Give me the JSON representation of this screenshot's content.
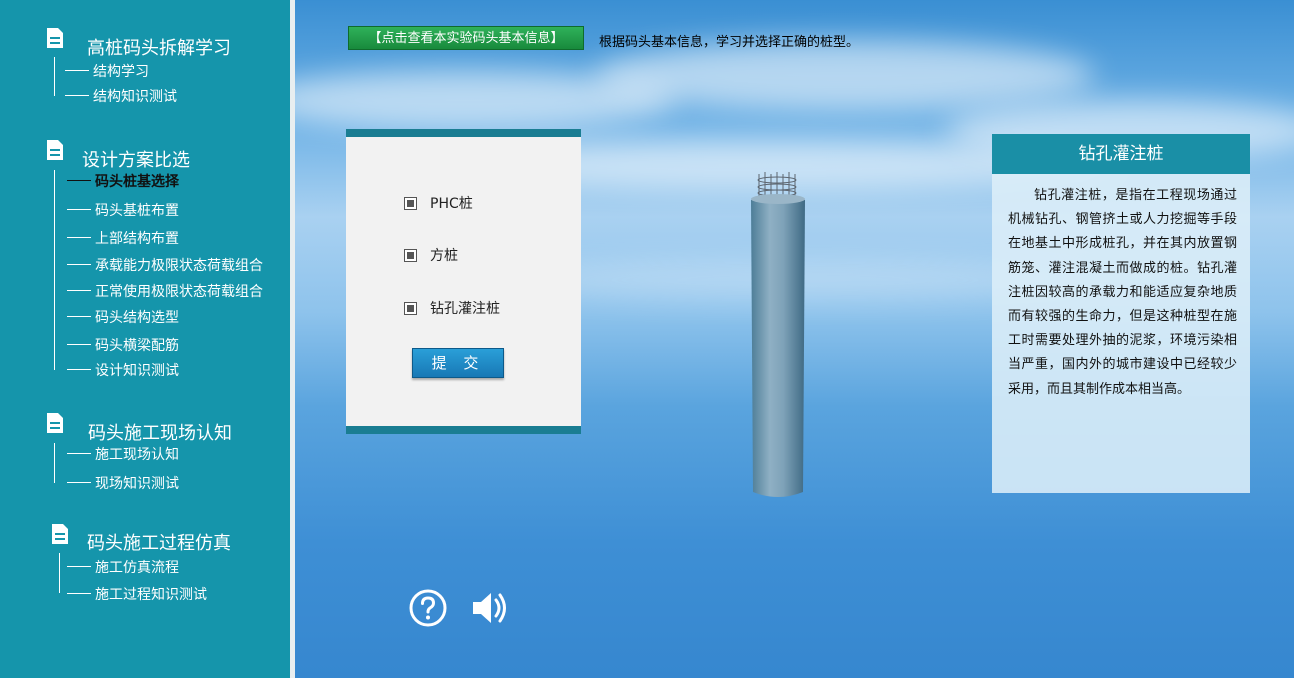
{
  "sidebar": {
    "sections": [
      {
        "title": "高桩码头拆解学习",
        "items": [
          "结构学习",
          "结构知识测试"
        ]
      },
      {
        "title": "设计方案比选",
        "items": [
          "码头桩基选择",
          "码头基桩布置",
          "上部结构布置",
          "承载能力极限状态荷载组合",
          "正常使用极限状态荷载组合",
          "码头结构选型",
          "码头横梁配筋",
          "设计知识测试"
        ]
      },
      {
        "title": "码头施工现场认知",
        "items": [
          "施工现场认知",
          "现场知识测试"
        ]
      },
      {
        "title": "码头施工过程仿真",
        "items": [
          "施工仿真流程",
          "施工过程知识测试"
        ]
      }
    ],
    "active_item": "码头桩基选择"
  },
  "main": {
    "info_button": "【点击查看本实验码头基本信息】",
    "instruction": "根据码头基本信息，学习并选择正确的桩型。",
    "options": [
      "PHC桩",
      "方桩",
      "钻孔灌注桩"
    ],
    "submit": "提 交",
    "info_panel": {
      "title": "钻孔灌注桩",
      "body": "钻孔灌注桩，是指在工程现场通过机械钻孔、钢管挤土或人力挖掘等手段在地基土中形成桩孔，并在其内放置钢筋笼、灌注混凝土而做成的桩。钻孔灌注桩因较高的承载力和能适应复杂地质而有较强的生命力，但是这种桩型在施工时需要处理外抽的泥浆，环境污染相当严重，国内外的城市建设中已经较少采用，而且其制作成本相当高。"
    },
    "icons": [
      "help-icon",
      "speaker-icon"
    ]
  },
  "colors": {
    "sidebar": "#1595ab",
    "accent": "#1a8fa6",
    "info_button": "#1e9b48",
    "submit": "#1d8cc8"
  }
}
